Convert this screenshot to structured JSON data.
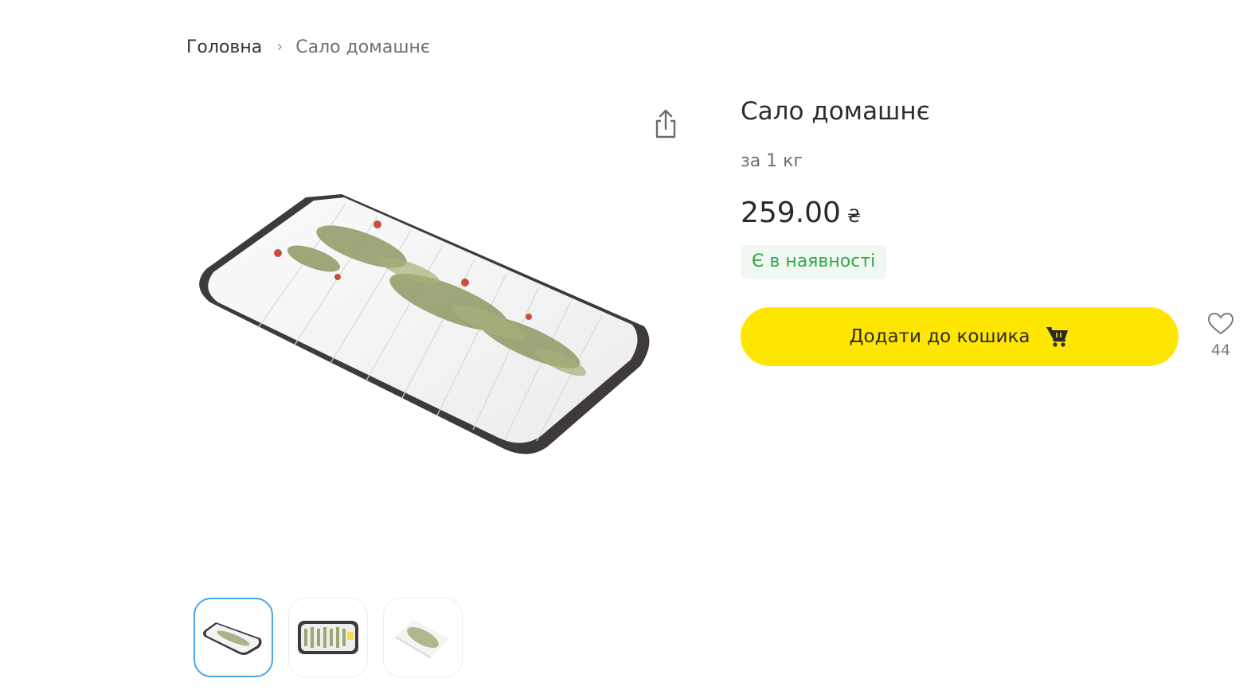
{
  "breadcrumb": {
    "home": "Головна",
    "separator": "›",
    "current": "Сало домашнє"
  },
  "product": {
    "title": "Сало домашнє",
    "unit": "за 1 кг",
    "price": "259.00",
    "currency": "₴",
    "availability": "Є в наявності",
    "add_to_cart_label": "Додати до кошика",
    "favorites_count": "44"
  },
  "icons": {
    "share": "share-icon",
    "cart": "cart-icon",
    "favorite": "heart-icon"
  },
  "gallery": {
    "thumbnails": [
      "product-photo-1",
      "product-photo-2",
      "product-photo-3"
    ],
    "selected_thumbnail": 1
  },
  "colors": {
    "accent_button": "#ffe600",
    "availability_text": "#2fa84f",
    "availability_bg": "#f1f8f1",
    "thumb_active_border": "#4aa7e6"
  }
}
